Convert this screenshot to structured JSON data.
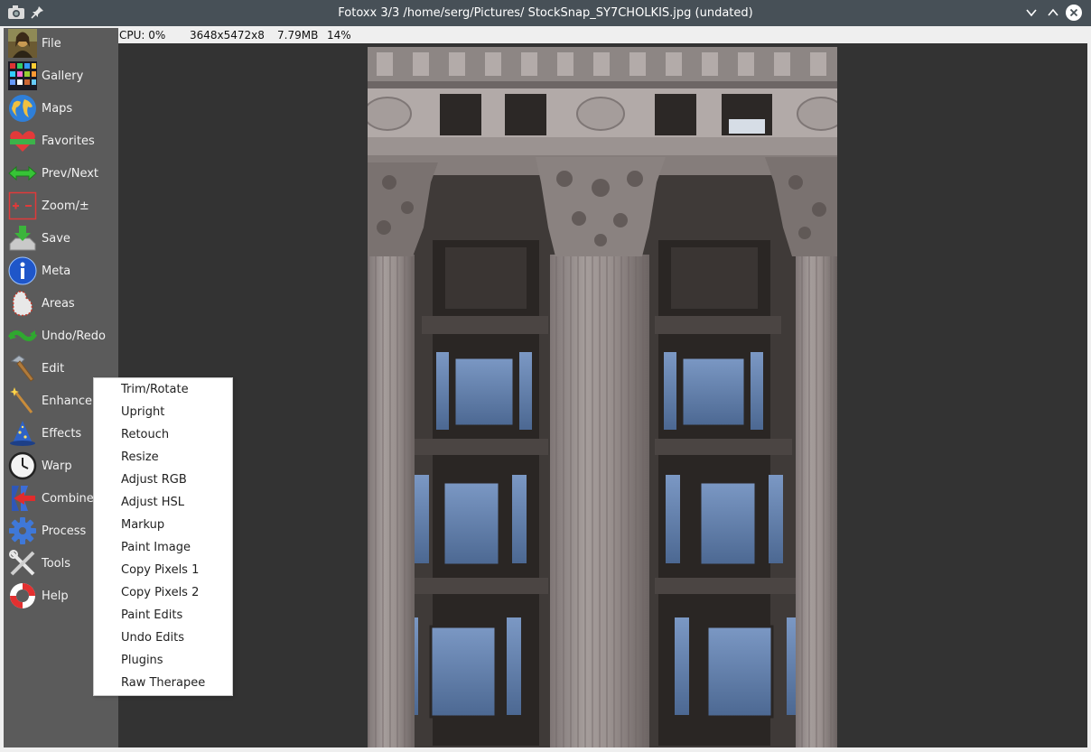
{
  "window": {
    "title": "Fotoxx 3/3 /home/serg/Pictures/ StockSnap_SY7CHOLKIS.jpg (undated)"
  },
  "status": {
    "cpu": "CPU: 0%",
    "dims": "3648x5472x8",
    "size": "7.79MB",
    "zoom": "14%"
  },
  "sidebar": {
    "items": [
      {
        "label": "File",
        "icon": "mona-lisa-icon"
      },
      {
        "label": "Gallery",
        "icon": "gallery-grid-icon"
      },
      {
        "label": "Maps",
        "icon": "globe-icon"
      },
      {
        "label": "Favorites",
        "icon": "heart-icon"
      },
      {
        "label": "Prev/Next",
        "icon": "double-arrow-icon"
      },
      {
        "label": "Zoom/±",
        "icon": "zoom-icon"
      },
      {
        "label": "Save",
        "icon": "save-icon"
      },
      {
        "label": "Meta",
        "icon": "info-icon"
      },
      {
        "label": "Areas",
        "icon": "area-select-icon"
      },
      {
        "label": "Undo/Redo",
        "icon": "undo-redo-icon"
      },
      {
        "label": "Edit",
        "icon": "hammer-icon"
      },
      {
        "label": "Enhance",
        "icon": "magic-wand-icon"
      },
      {
        "label": "Effects",
        "icon": "wizard-hat-icon"
      },
      {
        "label": "Warp",
        "icon": "clock-icon"
      },
      {
        "label": "Combine",
        "icon": "combine-icon"
      },
      {
        "label": "Process",
        "icon": "gear-icon"
      },
      {
        "label": "Tools",
        "icon": "tools-icon"
      },
      {
        "label": "Help",
        "icon": "lifebuoy-icon"
      }
    ]
  },
  "edit_menu": {
    "items": [
      "Trim/Rotate",
      "Upright",
      "Retouch",
      "Resize",
      "Adjust RGB",
      "Adjust HSL",
      "Markup",
      "Paint Image",
      "Copy Pixels 1",
      "Copy Pixels 2",
      "Paint Edits",
      "Undo Edits",
      "Plugins",
      "Raw Therapee"
    ]
  },
  "colors": {
    "titlebar": "#475057",
    "sidebar": "#5b5b5b",
    "canvas": "#333333"
  }
}
